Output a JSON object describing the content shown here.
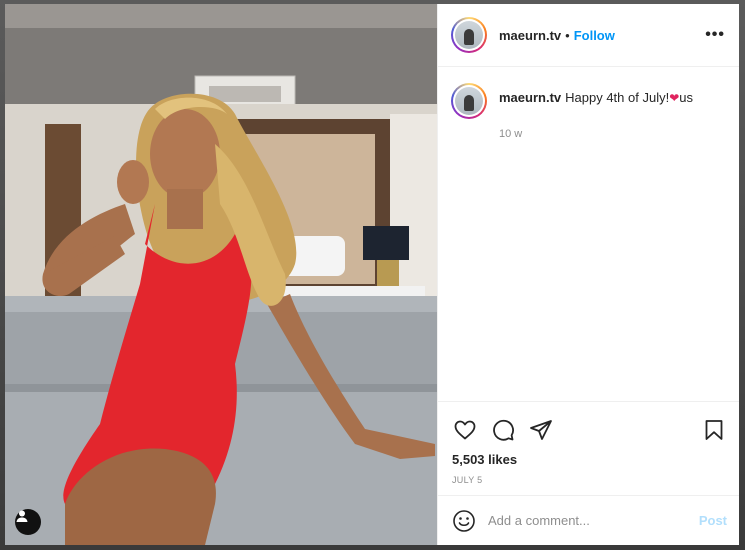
{
  "post": {
    "username": "maeurn.tv",
    "follow_label": "Follow",
    "separator": "•",
    "more_label": "•••",
    "caption": {
      "username": "maeurn.tv",
      "text": "Happy 4th of July!",
      "emoji": "❤",
      "suffix": "us"
    },
    "time_ago": "10 w",
    "likes": "5,503 likes",
    "date": "JULY 5"
  },
  "comment_box": {
    "placeholder": "Add a comment...",
    "post_label": "Post"
  },
  "icons": {
    "like": "heart-icon",
    "comment": "comment-icon",
    "share": "share-icon",
    "save": "bookmark-icon",
    "emoji": "emoji-icon",
    "photo_user": "user-tag-icon"
  },
  "colors": {
    "link": "#0095f6",
    "post_disabled": "#b2dffc",
    "dress": "#e3262d"
  }
}
